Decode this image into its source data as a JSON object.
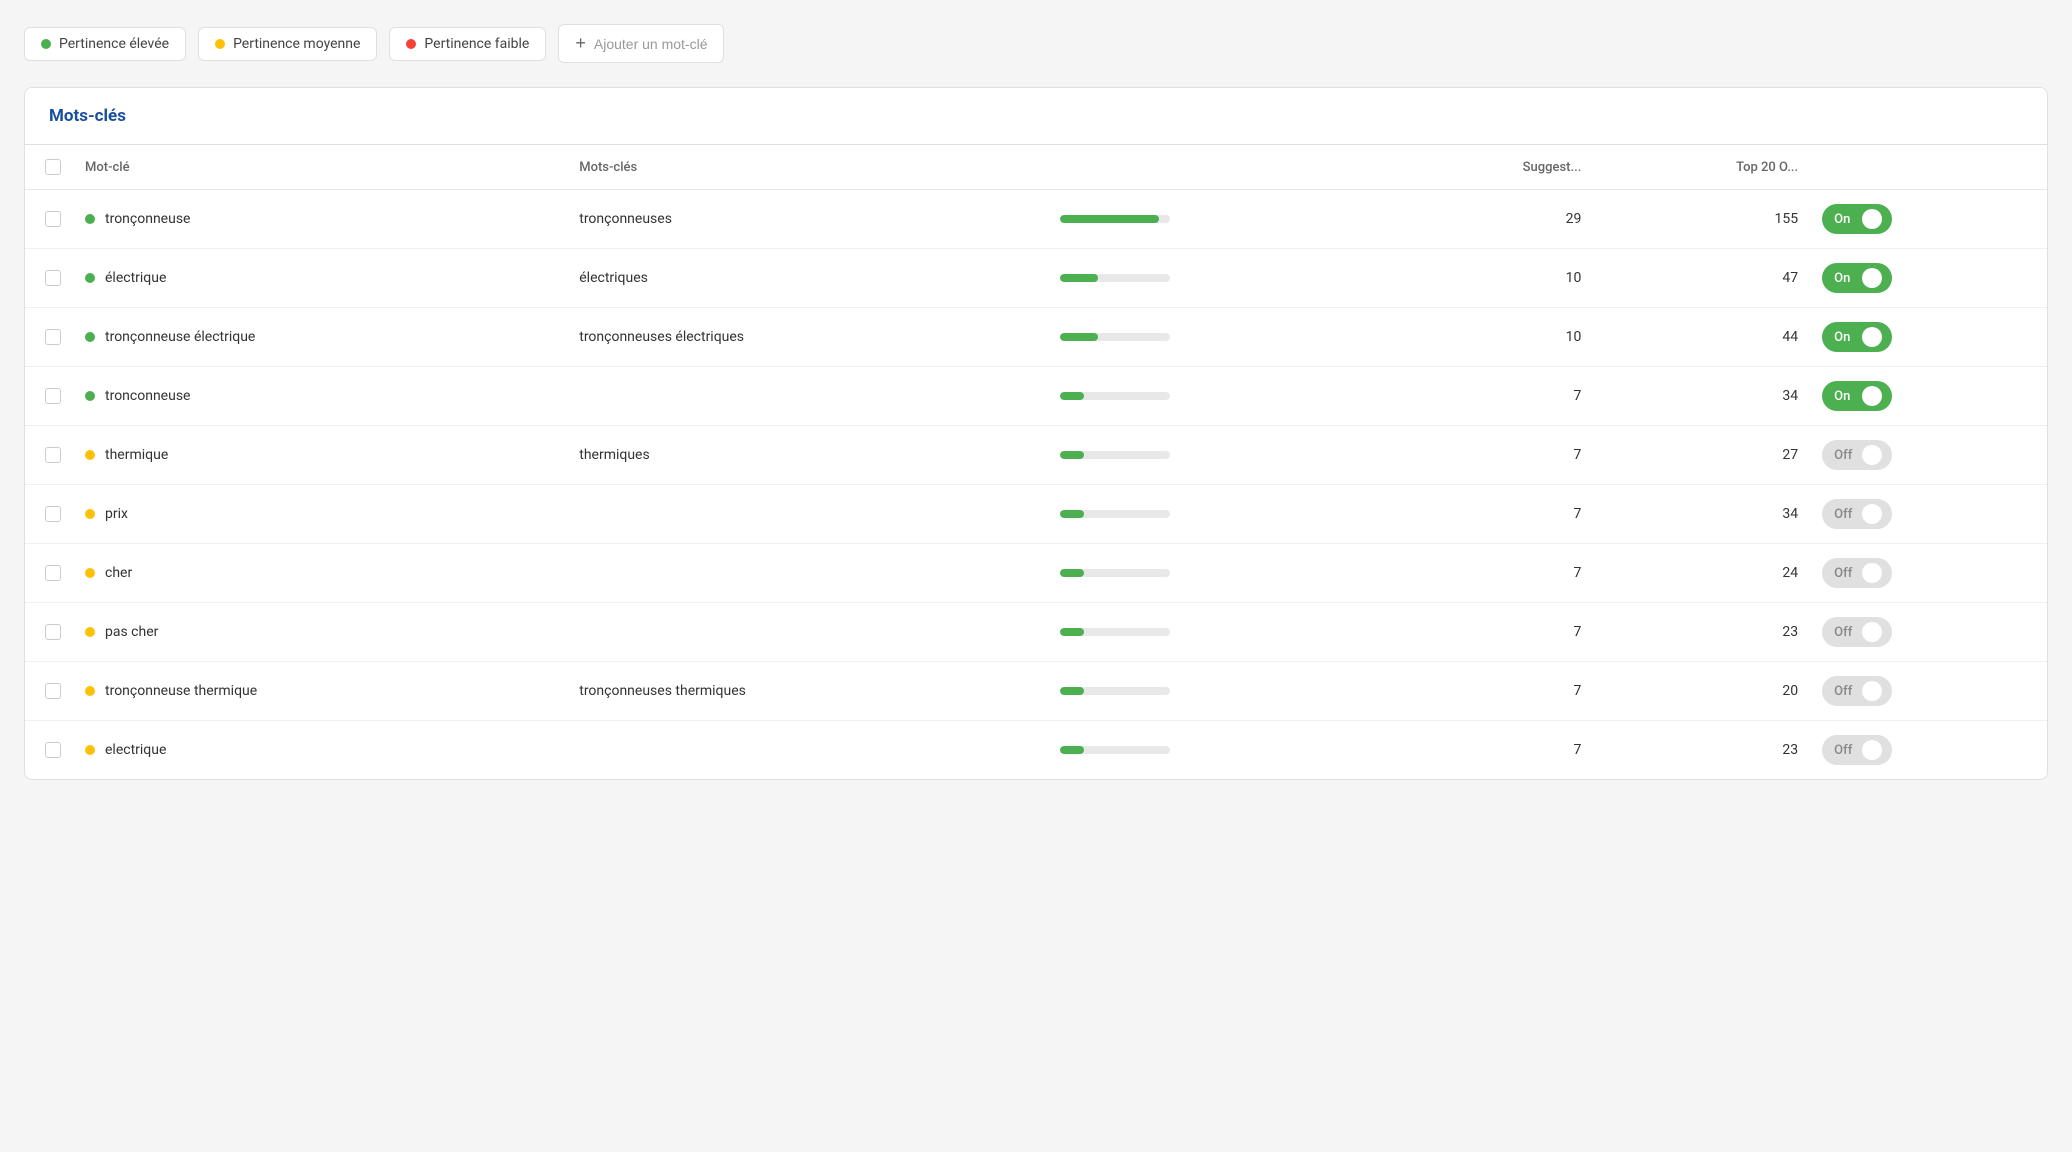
{
  "legend": {
    "high_label": "Pertinence élevée",
    "medium_label": "Pertinence moyenne",
    "low_label": "Pertinence faible"
  },
  "add_button": {
    "plus": "+",
    "placeholder": "Ajouter un mot-clé"
  },
  "table": {
    "title": "Mots-clés",
    "headers": {
      "keyword": "Mot-clé",
      "keywords_plural": "Mots-clés",
      "suggestions": "Suggest...",
      "top20": "Top 20 O..."
    },
    "rows": [
      {
        "keyword": "tronçonneuse",
        "dot": "green",
        "keywords_plural": "tronçonneuses",
        "bar_pct": 90,
        "suggestions": 29,
        "top20": 155,
        "toggle": "on"
      },
      {
        "keyword": "électrique",
        "dot": "green",
        "keywords_plural": "électriques",
        "bar_pct": 35,
        "suggestions": 10,
        "top20": 47,
        "toggle": "on"
      },
      {
        "keyword": "tronçonneuse électrique",
        "dot": "green",
        "keywords_plural": "tronçonneuses électriques",
        "bar_pct": 35,
        "suggestions": 10,
        "top20": 44,
        "toggle": "on"
      },
      {
        "keyword": "tronconneuse",
        "dot": "green",
        "keywords_plural": "",
        "bar_pct": 22,
        "suggestions": 7,
        "top20": 34,
        "toggle": "on"
      },
      {
        "keyword": "thermique",
        "dot": "yellow",
        "keywords_plural": "thermiques",
        "bar_pct": 22,
        "suggestions": 7,
        "top20": 27,
        "toggle": "off"
      },
      {
        "keyword": "prix",
        "dot": "yellow",
        "keywords_plural": "",
        "bar_pct": 22,
        "suggestions": 7,
        "top20": 34,
        "toggle": "off"
      },
      {
        "keyword": "cher",
        "dot": "yellow",
        "keywords_plural": "",
        "bar_pct": 22,
        "suggestions": 7,
        "top20": 24,
        "toggle": "off"
      },
      {
        "keyword": "pas cher",
        "dot": "yellow",
        "keywords_plural": "",
        "bar_pct": 22,
        "suggestions": 7,
        "top20": 23,
        "toggle": "off"
      },
      {
        "keyword": "tronçonneuse thermique",
        "dot": "yellow",
        "keywords_plural": "tronçonneuses thermiques",
        "bar_pct": 22,
        "suggestions": 7,
        "top20": 20,
        "toggle": "off"
      },
      {
        "keyword": "electrique",
        "dot": "yellow",
        "keywords_plural": "",
        "bar_pct": 22,
        "suggestions": 7,
        "top20": 23,
        "toggle": "off"
      }
    ]
  }
}
